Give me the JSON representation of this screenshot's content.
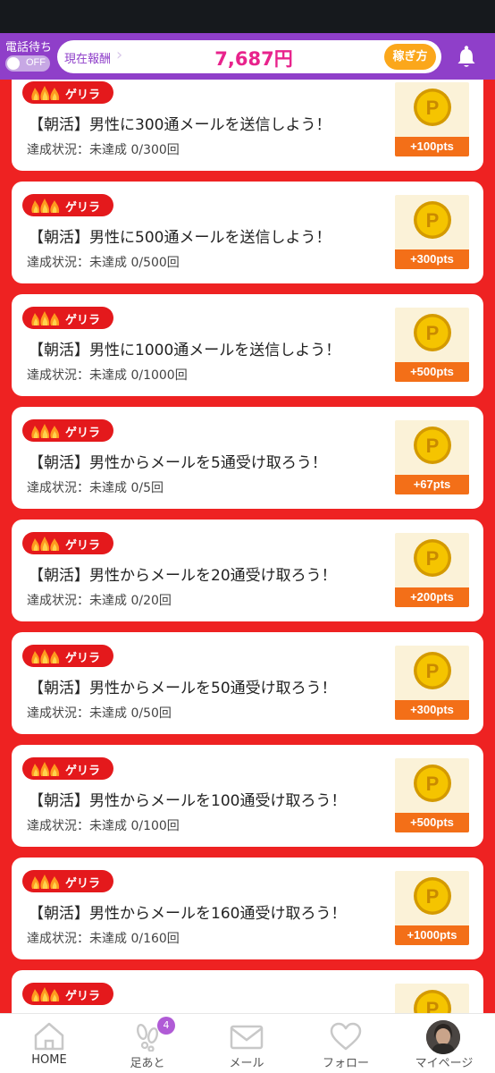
{
  "header": {
    "call_label": "電話待ち",
    "toggle_label": "OFF",
    "reward_label": "現在報酬",
    "reward_value": "7,687円",
    "earn_button": "稼ぎ方"
  },
  "missions": [
    {
      "badge": "ゲリラ",
      "title": "【朝活】男性に300通メールを送信しよう！",
      "status": "達成状況：未達成 0/300回",
      "points": "+100pts"
    },
    {
      "badge": "ゲリラ",
      "title": "【朝活】男性に500通メールを送信しよう！",
      "status": "達成状況：未達成 0/500回",
      "points": "+300pts"
    },
    {
      "badge": "ゲリラ",
      "title": "【朝活】男性に1000通メールを送信しよう！",
      "status": "達成状況：未達成 0/1000回",
      "points": "+500pts"
    },
    {
      "badge": "ゲリラ",
      "title": "【朝活】男性からメールを5通受け取ろう！",
      "status": "達成状況：未達成 0/5回",
      "points": "+67pts"
    },
    {
      "badge": "ゲリラ",
      "title": "【朝活】男性からメールを20通受け取ろう！",
      "status": "達成状況：未達成 0/20回",
      "points": "+200pts"
    },
    {
      "badge": "ゲリラ",
      "title": "【朝活】男性からメールを50通受け取ろう！",
      "status": "達成状況：未達成 0/50回",
      "points": "+300pts"
    },
    {
      "badge": "ゲリラ",
      "title": "【朝活】男性からメールを100通受け取ろう！",
      "status": "達成状況：未達成 0/100回",
      "points": "+500pts"
    },
    {
      "badge": "ゲリラ",
      "title": "【朝活】男性からメールを160通受け取ろう！",
      "status": "達成状況：未達成 0/160回",
      "points": "+1000pts"
    },
    {
      "badge": "ゲリラ",
      "title": "",
      "status": "",
      "points": ""
    }
  ],
  "nav": {
    "items": [
      {
        "label": "HOME",
        "icon": "home-icon"
      },
      {
        "label": "足あと",
        "icon": "footprints-icon",
        "badge": "4"
      },
      {
        "label": "メール",
        "icon": "mail-icon"
      },
      {
        "label": "フォロー",
        "icon": "heart-icon"
      },
      {
        "label": "マイページ",
        "icon": "avatar"
      }
    ]
  },
  "colors": {
    "background": "#ee2222",
    "header": "#8f3fc9",
    "reward_text": "#e8238c",
    "earn_button": "#fba71b",
    "points_bar": "#f36f18",
    "badge": "#e4191c"
  }
}
